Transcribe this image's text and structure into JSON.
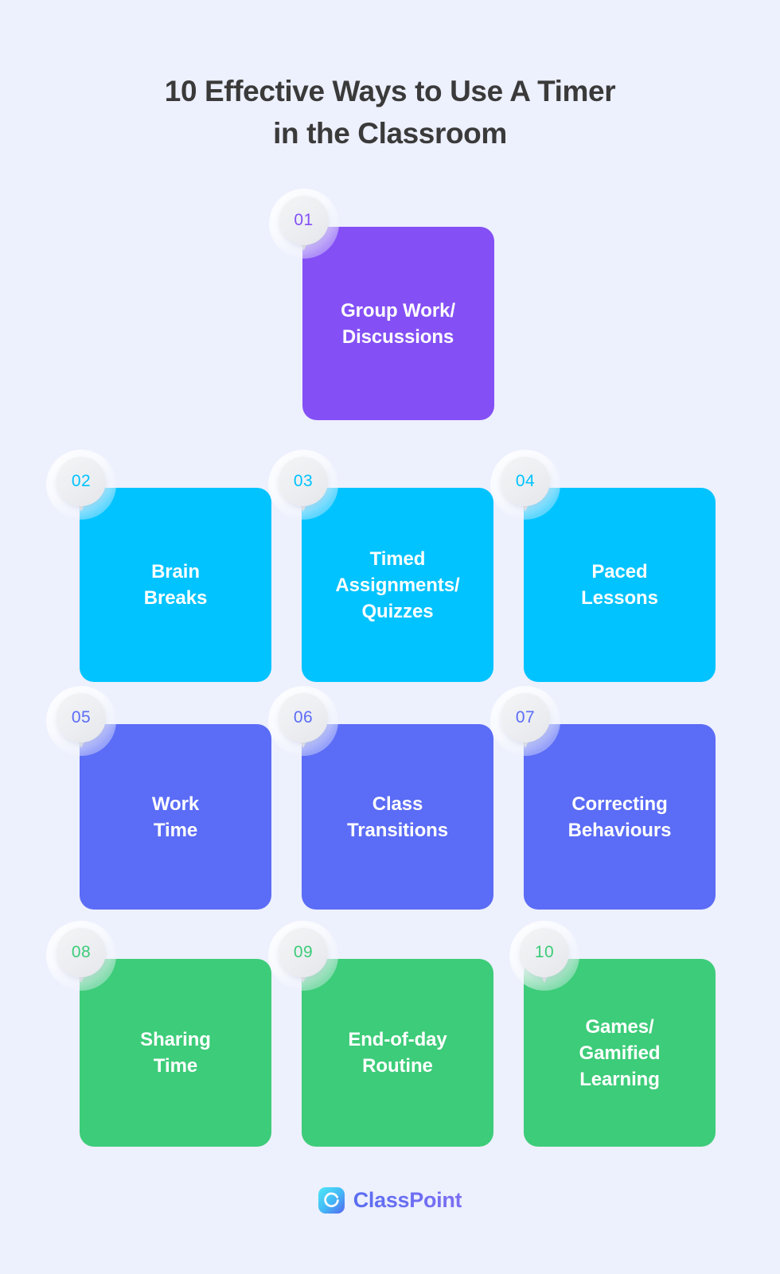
{
  "background_color": "#EDF0FD",
  "title": {
    "line1": "10 Effective Ways to Use A Timer",
    "line2": "in the Classroom",
    "color": "#3A3A3A"
  },
  "palette": {
    "purple": "#8450F5",
    "cyan": "#00C3FF",
    "indigo": "#5B6CF6",
    "green": "#3DCC79"
  },
  "cards": [
    {
      "number": "01",
      "label": "Group Work/\nDiscussions",
      "color": "#8450F5",
      "row": 1
    },
    {
      "number": "02",
      "label": "Brain\nBreaks",
      "color": "#00C3FF",
      "row": 2
    },
    {
      "number": "03",
      "label": "Timed\nAssignments/\nQuizzes",
      "color": "#00C3FF",
      "row": 2
    },
    {
      "number": "04",
      "label": "Paced\nLessons",
      "color": "#00C3FF",
      "row": 2
    },
    {
      "number": "05",
      "label": "Work\nTime",
      "color": "#5B6CF6",
      "row": 3
    },
    {
      "number": "06",
      "label": "Class\nTransitions",
      "color": "#5B6CF6",
      "row": 3
    },
    {
      "number": "07",
      "label": "Correcting\nBehaviours",
      "color": "#5B6CF6",
      "row": 3
    },
    {
      "number": "08",
      "label": "Sharing\nTime",
      "color": "#3DCC79",
      "row": 4
    },
    {
      "number": "09",
      "label": "End-of-day\nRoutine",
      "color": "#3DCC79",
      "row": 4
    },
    {
      "number": "10",
      "label": "Games/\nGamified\nLearning",
      "color": "#3DCC79",
      "row": 4
    }
  ],
  "footer": {
    "brand": "ClassPoint",
    "logo_icon": "classpoint-c-icon"
  }
}
